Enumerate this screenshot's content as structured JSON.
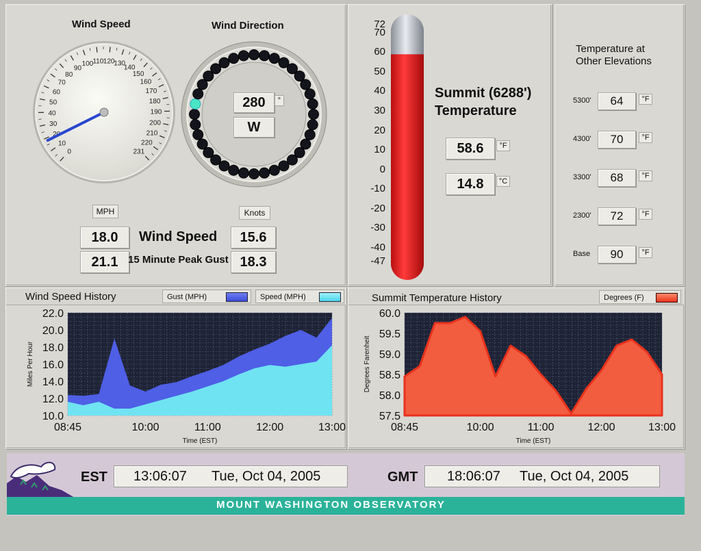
{
  "wind_speed_gauge": {
    "title": "Wind Speed",
    "dial_labels": [
      "0",
      "10",
      "20",
      "30",
      "40",
      "50",
      "60",
      "70",
      "80",
      "90",
      "100",
      "110",
      "120",
      "130",
      "140",
      "150",
      "160",
      "170",
      "180",
      "190",
      "200",
      "210",
      "220",
      "231"
    ],
    "needle_value": 18.0
  },
  "wind_direction": {
    "title": "Wind Direction",
    "degrees": "280",
    "degree_unit": "°",
    "compass": "W",
    "indicator_degrees": 280
  },
  "wind_readouts": {
    "mph_unit": "MPH",
    "knots_unit": "Knots",
    "speed_label": "Wind Speed",
    "gust_label": "15 Minute Peak Gust",
    "speed_mph": "18.0",
    "gust_mph": "21.1",
    "speed_knots": "15.6",
    "gust_knots": "18.3"
  },
  "summit_temp": {
    "title_line1": "Summit (6288')",
    "title_line2": "Temperature",
    "fahrenheit": "58.6",
    "f_unit": "°F",
    "celsius": "14.8",
    "c_unit": "°C",
    "scale_labels": [
      "72",
      "70",
      "60",
      "50",
      "40",
      "30",
      "20",
      "10",
      "0",
      "-10",
      "-20",
      "-30",
      "-40",
      "-47"
    ],
    "fill_value": 58.6,
    "scale_min": -47,
    "scale_max": 72
  },
  "elevations": {
    "title_line1": "Temperature at",
    "title_line2": "Other Elevations",
    "unit": "°F",
    "rows": [
      {
        "label": "5300'",
        "value": "64"
      },
      {
        "label": "4300'",
        "value": "70"
      },
      {
        "label": "3300'",
        "value": "68"
      },
      {
        "label": "2300'",
        "value": "72"
      },
      {
        "label": "Base",
        "value": "90"
      }
    ]
  },
  "wind_history": {
    "title": "Wind Speed History",
    "legend_gust": "Gust (MPH)",
    "legend_speed": "Speed (MPH)",
    "xlabel": "Time (EST)",
    "ylabel": "Miles Per Hour"
  },
  "temp_history": {
    "title": "Summit Temperature History",
    "legend": "Degrees (F)",
    "xlabel": "Time (EST)",
    "ylabel": "Degrees Farenheit"
  },
  "chart_data": [
    {
      "type": "area",
      "title": "Wind Speed History",
      "xlabel": "Time (EST)",
      "ylabel": "Miles Per Hour",
      "xlim": [
        "08:45",
        "13:00"
      ],
      "ylim": [
        10.0,
        22.0
      ],
      "x_ticks": [
        "08:45",
        "10:00",
        "11:00",
        "12:00",
        "13:00"
      ],
      "y_ticks": [
        "10.0",
        "12.0",
        "14.0",
        "16.0",
        "18.0",
        "20.0",
        "22.0"
      ],
      "x": [
        "08:45",
        "09:00",
        "09:15",
        "09:30",
        "09:45",
        "10:00",
        "10:15",
        "10:30",
        "10:45",
        "11:00",
        "11:15",
        "11:30",
        "11:45",
        "12:00",
        "12:15",
        "12:30",
        "12:45",
        "13:00"
      ],
      "series": [
        {
          "name": "Gust (MPH)",
          "color": "#4f5fe6",
          "values": [
            12.4,
            12.3,
            12.5,
            19.0,
            13.5,
            12.8,
            13.6,
            13.9,
            14.6,
            15.2,
            15.9,
            16.9,
            17.7,
            18.4,
            19.3,
            20.0,
            19.1,
            21.4
          ]
        },
        {
          "name": "Speed (MPH)",
          "color": "#6fe3f2",
          "values": [
            11.6,
            11.2,
            11.6,
            10.8,
            10.8,
            11.3,
            11.8,
            12.3,
            12.8,
            13.4,
            14.0,
            14.8,
            15.5,
            15.9,
            15.7,
            16.0,
            16.3,
            18.2
          ]
        }
      ],
      "grid": true
    },
    {
      "type": "area",
      "title": "Summit Temperature History",
      "xlabel": "Time (EST)",
      "ylabel": "Degrees Farenheit",
      "xlim": [
        "08:45",
        "13:00"
      ],
      "ylim": [
        57.5,
        60.0
      ],
      "x_ticks": [
        "08:45",
        "10:00",
        "11:00",
        "12:00",
        "13:00"
      ],
      "y_ticks": [
        "57.5",
        "58.0",
        "58.5",
        "59.0",
        "59.5",
        "60.0"
      ],
      "x": [
        "08:45",
        "09:00",
        "09:15",
        "09:30",
        "09:45",
        "10:00",
        "10:15",
        "10:30",
        "10:45",
        "11:00",
        "11:15",
        "11:30",
        "11:45",
        "12:00",
        "12:15",
        "12:30",
        "12:45",
        "13:00"
      ],
      "series": [
        {
          "name": "Degrees (F)",
          "color": "#f25c3f",
          "values": [
            58.45,
            58.7,
            59.75,
            59.75,
            59.9,
            59.55,
            58.45,
            59.2,
            58.95,
            58.5,
            58.1,
            57.55,
            58.15,
            58.6,
            59.2,
            59.35,
            59.05,
            58.5
          ]
        }
      ],
      "grid": true
    }
  ],
  "footer": {
    "est_label": "EST",
    "est_time": "13:06:07",
    "est_date": "Tue, Oct 04, 2005",
    "gmt_label": "GMT",
    "gmt_time": "18:06:07",
    "gmt_date": "Tue, Oct 04, 2005",
    "banner": "MOUNT WASHINGTON OBSERVATORY"
  },
  "colors": {
    "thermo_red": "#e61e1e",
    "banner_teal": "#2bb39a",
    "footer_bg": "#d5c8d6",
    "chart_bg": "#1e2336"
  }
}
